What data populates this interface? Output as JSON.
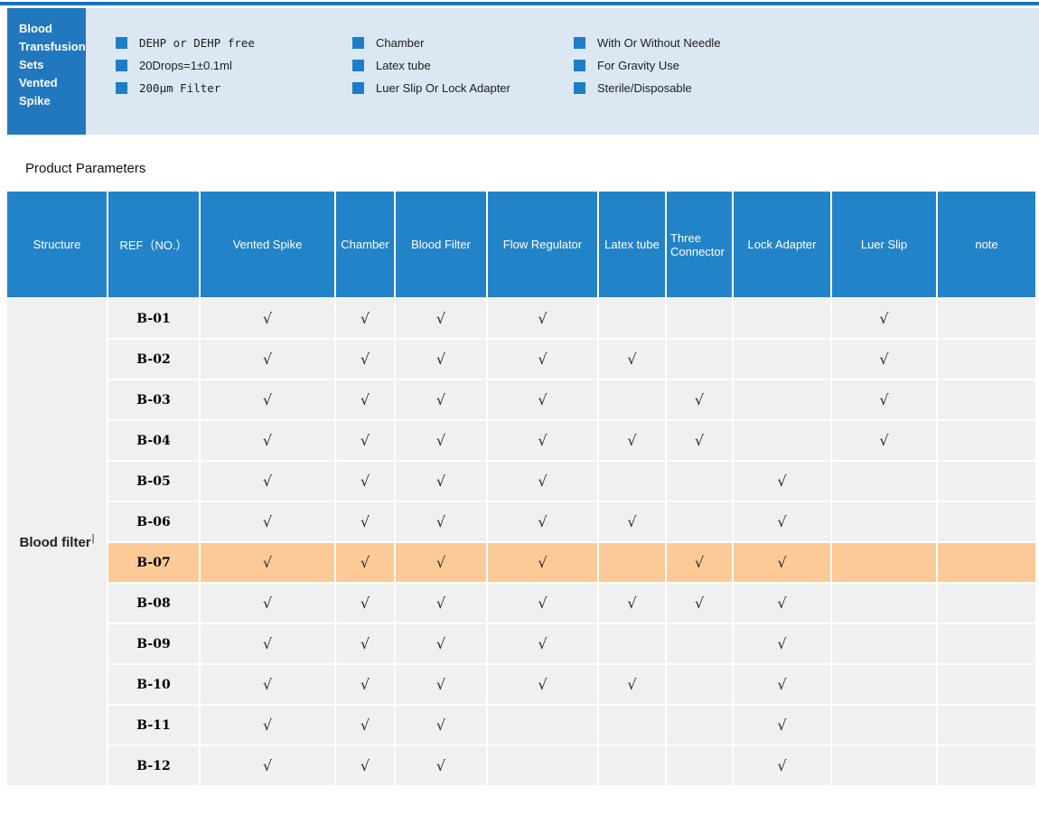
{
  "hero": {
    "title_lines": [
      "Blood",
      "Transfusion",
      "Sets",
      "Vented",
      "Spike"
    ],
    "features": {
      "col1": [
        "DEHP or DEHP free",
        "20Drops=1±0.1ml",
        "200μm Filter"
      ],
      "col2": [
        "Chamber",
        "Latex tube",
        "Luer Slip Or Lock Adapter"
      ],
      "col3": [
        "With Or Without Needle",
        "For Gravity Use",
        "Sterile/Disposable"
      ]
    }
  },
  "section": {
    "title": "Product Parameters"
  },
  "table": {
    "check_glyph": "√",
    "columns": [
      "Structure",
      "REF（NO.）",
      "Vented Spike",
      "Chamber",
      "Blood Filter",
      "Flow Regulator",
      "Latex tube",
      "Three Connector",
      "Lock Adapter",
      "Luer Slip",
      "note"
    ],
    "structure_label": "Blood filter",
    "structure_cursor": "|",
    "rows": [
      {
        "ref": "B-01",
        "checks": [
          1,
          1,
          1,
          1,
          0,
          0,
          0,
          1,
          0
        ],
        "highlight": false
      },
      {
        "ref": "B-02",
        "checks": [
          1,
          1,
          1,
          1,
          1,
          0,
          0,
          1,
          0
        ],
        "highlight": false
      },
      {
        "ref": "B-03",
        "checks": [
          1,
          1,
          1,
          1,
          0,
          1,
          0,
          1,
          0
        ],
        "highlight": false
      },
      {
        "ref": "B-04",
        "checks": [
          1,
          1,
          1,
          1,
          1,
          1,
          0,
          1,
          0
        ],
        "highlight": false
      },
      {
        "ref": "B-05",
        "checks": [
          1,
          1,
          1,
          1,
          0,
          0,
          1,
          0,
          0
        ],
        "highlight": false
      },
      {
        "ref": "B-06",
        "checks": [
          1,
          1,
          1,
          1,
          1,
          0,
          1,
          0,
          0
        ],
        "highlight": false
      },
      {
        "ref": "B-07",
        "checks": [
          1,
          1,
          1,
          1,
          0,
          1,
          1,
          0,
          0
        ],
        "highlight": true
      },
      {
        "ref": "B-08",
        "checks": [
          1,
          1,
          1,
          1,
          1,
          1,
          1,
          0,
          0
        ],
        "highlight": false
      },
      {
        "ref": "B-09",
        "checks": [
          1,
          1,
          1,
          1,
          0,
          0,
          1,
          0,
          0
        ],
        "highlight": false
      },
      {
        "ref": "B-10",
        "checks": [
          1,
          1,
          1,
          1,
          1,
          0,
          1,
          0,
          0
        ],
        "highlight": false
      },
      {
        "ref": "B-11",
        "checks": [
          1,
          1,
          1,
          0,
          0,
          0,
          1,
          0,
          0
        ],
        "highlight": false
      },
      {
        "ref": "B-12",
        "checks": [
          1,
          1,
          1,
          0,
          0,
          0,
          1,
          0,
          0
        ],
        "highlight": false
      }
    ]
  },
  "colors": {
    "accent_blue": "#2283c8",
    "hero_box_blue": "#2278bf",
    "banner_light_blue": "#dbe8f4",
    "bullet_blue": "#1e7dc6",
    "top_line_blue": "#1b74ba",
    "body_gray": "#f0f0f0",
    "highlight_orange": "#fcca96"
  }
}
